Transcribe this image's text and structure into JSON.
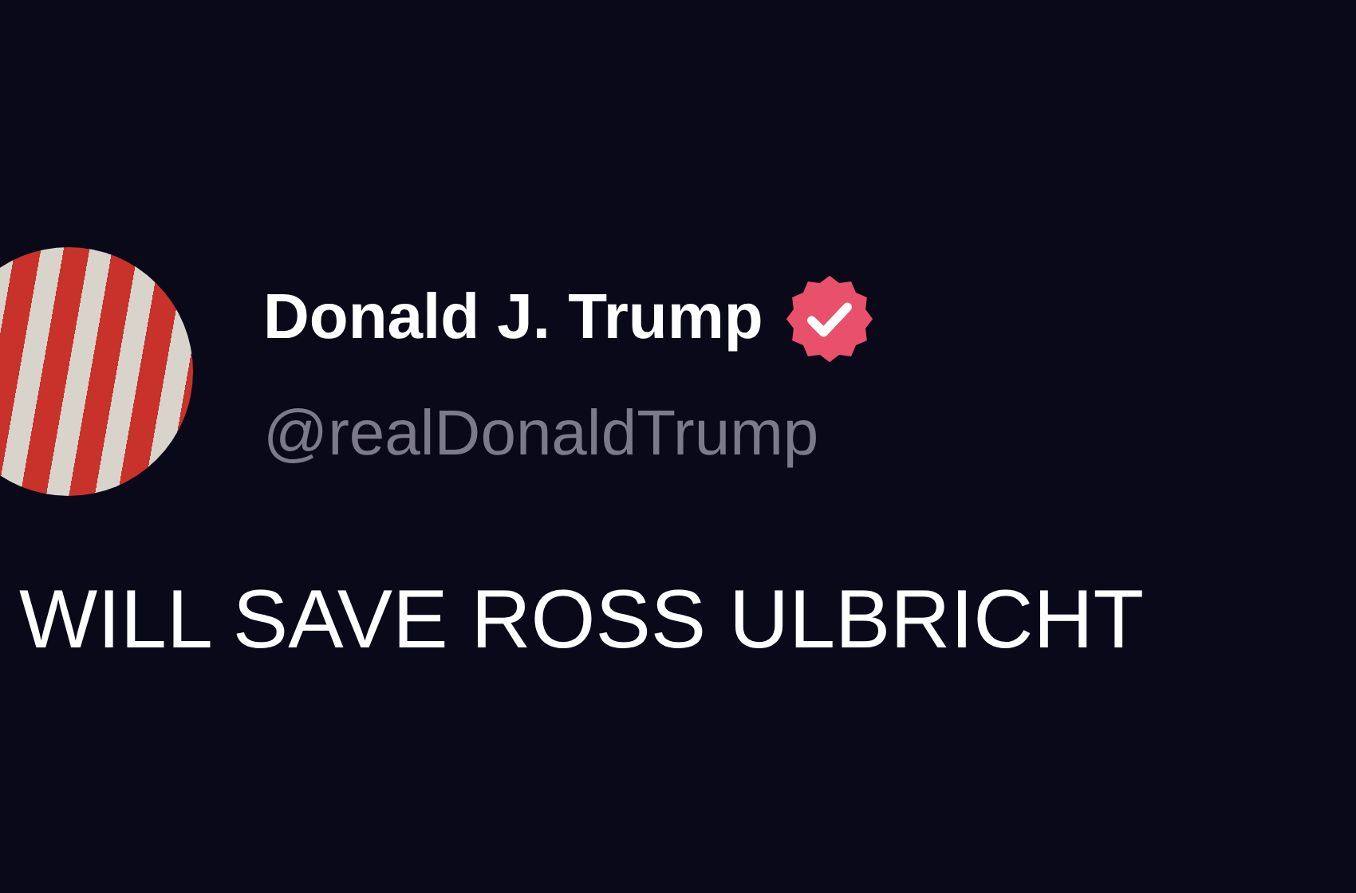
{
  "post": {
    "author": {
      "name": "Donald J. Trump",
      "verified": true,
      "handle": "@realDonaldTrump"
    },
    "text": "WILL SAVE ROSS ULBRICHT"
  }
}
